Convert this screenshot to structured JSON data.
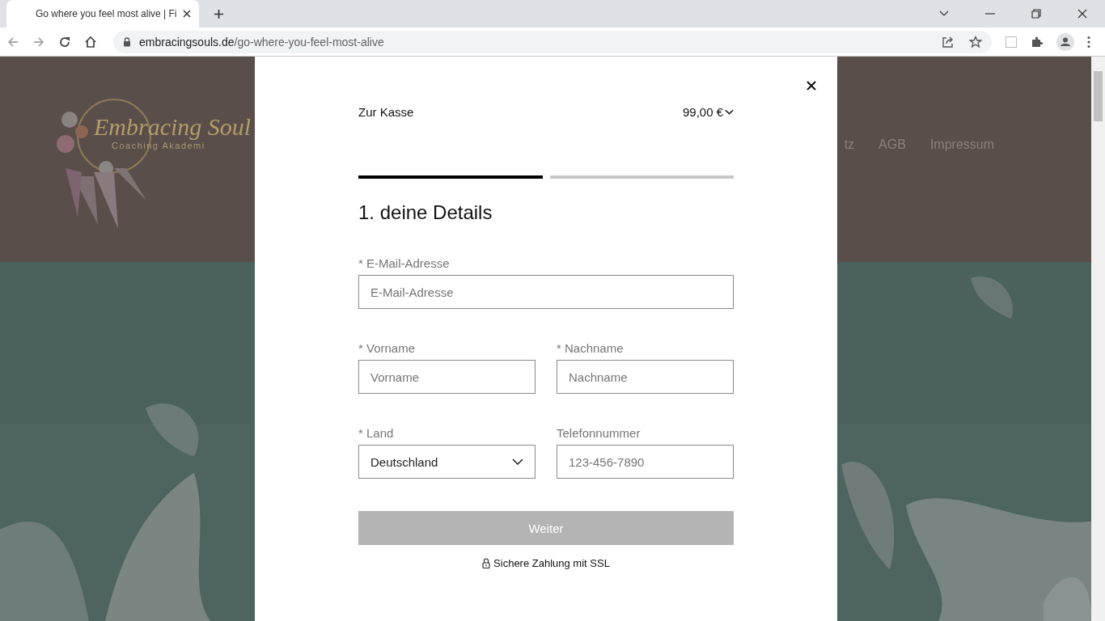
{
  "browser": {
    "tab": {
      "title": "Go where you feel most alive | Fi",
      "selected": true
    },
    "url": {
      "host": "embracingsouls.de",
      "path": "/go-where-you-feel-most-alive"
    }
  },
  "site": {
    "logo": {
      "name": "Embracing Soul",
      "tagline": "Coaching Akademi"
    },
    "nav": [
      "tz",
      "AGB",
      "Impressum"
    ]
  },
  "checkout": {
    "title": "Zur Kasse",
    "price": "99,00 €",
    "steps": [
      {
        "active": true
      },
      {
        "active": false
      }
    ],
    "heading": "1. deine Details",
    "rows": [
      [
        {
          "label": "* E-Mail-Adresse",
          "placeholder": "E-Mail-Adresse",
          "kind": "text"
        }
      ],
      [
        {
          "label": "* Vorname",
          "placeholder": "Vorname",
          "kind": "text"
        },
        {
          "label": "* Nachname",
          "placeholder": "Nachname",
          "kind": "text"
        }
      ],
      [
        {
          "label": "* Land",
          "value": "Deutschland",
          "kind": "select"
        },
        {
          "label": "Telefonnummer",
          "placeholder": "123-456-7890",
          "kind": "text"
        }
      ]
    ],
    "button": {
      "label": "Weiter",
      "disabled": true
    },
    "secure_note": "Sichere Zahlung mit SSL"
  }
}
